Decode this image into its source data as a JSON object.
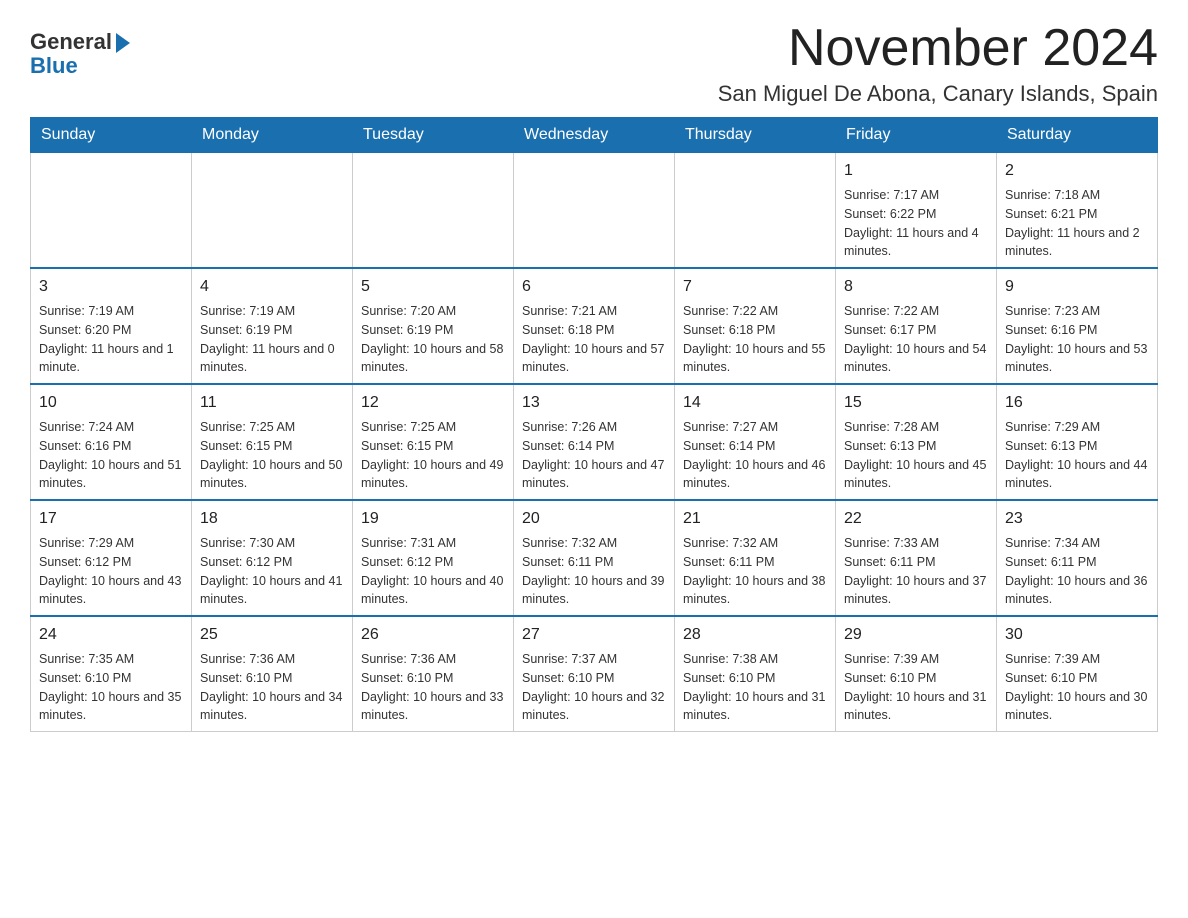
{
  "header": {
    "logo_text_general": "General",
    "logo_text_blue": "Blue",
    "month_title": "November 2024",
    "location": "San Miguel De Abona, Canary Islands, Spain"
  },
  "days_of_week": [
    "Sunday",
    "Monday",
    "Tuesday",
    "Wednesday",
    "Thursday",
    "Friday",
    "Saturday"
  ],
  "weeks": [
    [
      {
        "day": "",
        "sunrise": "",
        "sunset": "",
        "daylight": ""
      },
      {
        "day": "",
        "sunrise": "",
        "sunset": "",
        "daylight": ""
      },
      {
        "day": "",
        "sunrise": "",
        "sunset": "",
        "daylight": ""
      },
      {
        "day": "",
        "sunrise": "",
        "sunset": "",
        "daylight": ""
      },
      {
        "day": "",
        "sunrise": "",
        "sunset": "",
        "daylight": ""
      },
      {
        "day": "1",
        "sunrise": "Sunrise: 7:17 AM",
        "sunset": "Sunset: 6:22 PM",
        "daylight": "Daylight: 11 hours and 4 minutes."
      },
      {
        "day": "2",
        "sunrise": "Sunrise: 7:18 AM",
        "sunset": "Sunset: 6:21 PM",
        "daylight": "Daylight: 11 hours and 2 minutes."
      }
    ],
    [
      {
        "day": "3",
        "sunrise": "Sunrise: 7:19 AM",
        "sunset": "Sunset: 6:20 PM",
        "daylight": "Daylight: 11 hours and 1 minute."
      },
      {
        "day": "4",
        "sunrise": "Sunrise: 7:19 AM",
        "sunset": "Sunset: 6:19 PM",
        "daylight": "Daylight: 11 hours and 0 minutes."
      },
      {
        "day": "5",
        "sunrise": "Sunrise: 7:20 AM",
        "sunset": "Sunset: 6:19 PM",
        "daylight": "Daylight: 10 hours and 58 minutes."
      },
      {
        "day": "6",
        "sunrise": "Sunrise: 7:21 AM",
        "sunset": "Sunset: 6:18 PM",
        "daylight": "Daylight: 10 hours and 57 minutes."
      },
      {
        "day": "7",
        "sunrise": "Sunrise: 7:22 AM",
        "sunset": "Sunset: 6:18 PM",
        "daylight": "Daylight: 10 hours and 55 minutes."
      },
      {
        "day": "8",
        "sunrise": "Sunrise: 7:22 AM",
        "sunset": "Sunset: 6:17 PM",
        "daylight": "Daylight: 10 hours and 54 minutes."
      },
      {
        "day": "9",
        "sunrise": "Sunrise: 7:23 AM",
        "sunset": "Sunset: 6:16 PM",
        "daylight": "Daylight: 10 hours and 53 minutes."
      }
    ],
    [
      {
        "day": "10",
        "sunrise": "Sunrise: 7:24 AM",
        "sunset": "Sunset: 6:16 PM",
        "daylight": "Daylight: 10 hours and 51 minutes."
      },
      {
        "day": "11",
        "sunrise": "Sunrise: 7:25 AM",
        "sunset": "Sunset: 6:15 PM",
        "daylight": "Daylight: 10 hours and 50 minutes."
      },
      {
        "day": "12",
        "sunrise": "Sunrise: 7:25 AM",
        "sunset": "Sunset: 6:15 PM",
        "daylight": "Daylight: 10 hours and 49 minutes."
      },
      {
        "day": "13",
        "sunrise": "Sunrise: 7:26 AM",
        "sunset": "Sunset: 6:14 PM",
        "daylight": "Daylight: 10 hours and 47 minutes."
      },
      {
        "day": "14",
        "sunrise": "Sunrise: 7:27 AM",
        "sunset": "Sunset: 6:14 PM",
        "daylight": "Daylight: 10 hours and 46 minutes."
      },
      {
        "day": "15",
        "sunrise": "Sunrise: 7:28 AM",
        "sunset": "Sunset: 6:13 PM",
        "daylight": "Daylight: 10 hours and 45 minutes."
      },
      {
        "day": "16",
        "sunrise": "Sunrise: 7:29 AM",
        "sunset": "Sunset: 6:13 PM",
        "daylight": "Daylight: 10 hours and 44 minutes."
      }
    ],
    [
      {
        "day": "17",
        "sunrise": "Sunrise: 7:29 AM",
        "sunset": "Sunset: 6:12 PM",
        "daylight": "Daylight: 10 hours and 43 minutes."
      },
      {
        "day": "18",
        "sunrise": "Sunrise: 7:30 AM",
        "sunset": "Sunset: 6:12 PM",
        "daylight": "Daylight: 10 hours and 41 minutes."
      },
      {
        "day": "19",
        "sunrise": "Sunrise: 7:31 AM",
        "sunset": "Sunset: 6:12 PM",
        "daylight": "Daylight: 10 hours and 40 minutes."
      },
      {
        "day": "20",
        "sunrise": "Sunrise: 7:32 AM",
        "sunset": "Sunset: 6:11 PM",
        "daylight": "Daylight: 10 hours and 39 minutes."
      },
      {
        "day": "21",
        "sunrise": "Sunrise: 7:32 AM",
        "sunset": "Sunset: 6:11 PM",
        "daylight": "Daylight: 10 hours and 38 minutes."
      },
      {
        "day": "22",
        "sunrise": "Sunrise: 7:33 AM",
        "sunset": "Sunset: 6:11 PM",
        "daylight": "Daylight: 10 hours and 37 minutes."
      },
      {
        "day": "23",
        "sunrise": "Sunrise: 7:34 AM",
        "sunset": "Sunset: 6:11 PM",
        "daylight": "Daylight: 10 hours and 36 minutes."
      }
    ],
    [
      {
        "day": "24",
        "sunrise": "Sunrise: 7:35 AM",
        "sunset": "Sunset: 6:10 PM",
        "daylight": "Daylight: 10 hours and 35 minutes."
      },
      {
        "day": "25",
        "sunrise": "Sunrise: 7:36 AM",
        "sunset": "Sunset: 6:10 PM",
        "daylight": "Daylight: 10 hours and 34 minutes."
      },
      {
        "day": "26",
        "sunrise": "Sunrise: 7:36 AM",
        "sunset": "Sunset: 6:10 PM",
        "daylight": "Daylight: 10 hours and 33 minutes."
      },
      {
        "day": "27",
        "sunrise": "Sunrise: 7:37 AM",
        "sunset": "Sunset: 6:10 PM",
        "daylight": "Daylight: 10 hours and 32 minutes."
      },
      {
        "day": "28",
        "sunrise": "Sunrise: 7:38 AM",
        "sunset": "Sunset: 6:10 PM",
        "daylight": "Daylight: 10 hours and 31 minutes."
      },
      {
        "day": "29",
        "sunrise": "Sunrise: 7:39 AM",
        "sunset": "Sunset: 6:10 PM",
        "daylight": "Daylight: 10 hours and 31 minutes."
      },
      {
        "day": "30",
        "sunrise": "Sunrise: 7:39 AM",
        "sunset": "Sunset: 6:10 PM",
        "daylight": "Daylight: 10 hours and 30 minutes."
      }
    ]
  ]
}
